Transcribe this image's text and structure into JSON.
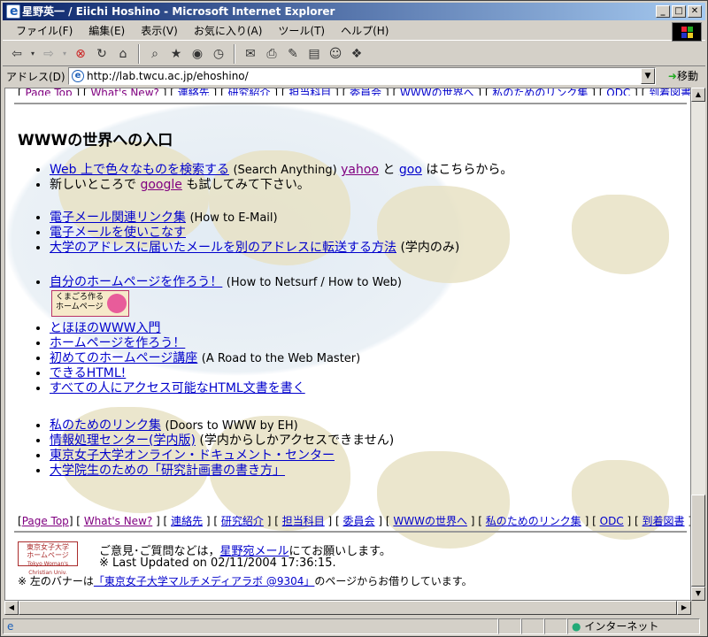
{
  "window": {
    "title": "星野英一 / Eiichi Hoshino - Microsoft Internet Explorer",
    "min": "_",
    "max": "□",
    "close": "✕"
  },
  "menu": [
    "ファイル(F)",
    "編集(E)",
    "表示(V)",
    "お気に入り(A)",
    "ツール(T)",
    "ヘルプ(H)"
  ],
  "address": {
    "label": "アドレス(D)",
    "url": "http://lab.twcu.ac.jp/ehoshino/",
    "go": "移動"
  },
  "nav": [
    {
      "label": "Page Top",
      "visited": true
    },
    {
      "label": "What's New?",
      "visited": true
    },
    {
      "label": "連絡先",
      "visited": false
    },
    {
      "label": "研究紹介",
      "visited": false
    },
    {
      "label": "担当科目",
      "visited": false
    },
    {
      "label": "委員会",
      "visited": false
    },
    {
      "label": "WWWの世界へ",
      "visited": false
    },
    {
      "label": "私のためのリンク集",
      "visited": false
    },
    {
      "label": "ODC",
      "visited": false
    },
    {
      "label": "到着図書",
      "visited": false
    }
  ],
  "section_title": "WWWの世界への入口",
  "list1": [
    {
      "link": "Web 上で色々なものを検索する",
      "text1": "(Search Anything)",
      "link2": "yahoo",
      "text2": "と",
      "link3": "goo",
      "text3": "はこちらから。"
    },
    {
      "text1": "新しいところで",
      "link": "google",
      "text2": "も試してみて下さい。"
    }
  ],
  "list2": [
    {
      "link": "電子メール関連リンク集",
      "text": "(How to E-Mail)"
    },
    {
      "link": "電子メールを使いこなす",
      "text": ""
    },
    {
      "link": "大学のアドレスに届いたメールを別のアドレスに転送する方法",
      "text": "(学内のみ)"
    }
  ],
  "list3": [
    {
      "link": "自分のホームページを作ろう！",
      "text": "(How to Netsurf / How to Web)"
    }
  ],
  "banner": {
    "line1": "くまごろ作る",
    "line2": "ホームページ"
  },
  "list4": [
    {
      "link": "とほほのWWW入門"
    },
    {
      "link": "ホームページを作ろう！"
    },
    {
      "link": "初めてのホームページ講座",
      "text": "(A Road to the Web Master)"
    },
    {
      "link": "できるHTML!"
    },
    {
      "link": "すべての人にアクセス可能なHTML文書を書く"
    }
  ],
  "list5": [
    {
      "link": "私のためのリンク集",
      "text": "(Doors to WWW by EH)"
    },
    {
      "link": "情報処理センター(学内版)",
      "text": "(学内からしかアクセスできません)"
    },
    {
      "link": "東京女子大学オンライン・ドキュメント・センター",
      "text": ""
    },
    {
      "link": "大学院生のための「研究計画書の書き方」",
      "text": ""
    }
  ],
  "footer": {
    "logo_line1": "東京女子大学",
    "logo_line2": "ホームページ",
    "logo_line3": "Tokyo Woman's Christian Univ.",
    "contact_pre": "ご意見･ご質問などは，",
    "contact_link": "星野宛メール",
    "contact_post": "にてお願いします。",
    "updated": "※ Last Updated on 02/11/2004 17:36:15.",
    "banner_pre": "※ 左のバナーは",
    "banner_link": "「東京女子大学マルチメディアラボ @9304」",
    "banner_post": "のページからお借りしています。"
  },
  "status": {
    "zone": "インターネット"
  }
}
